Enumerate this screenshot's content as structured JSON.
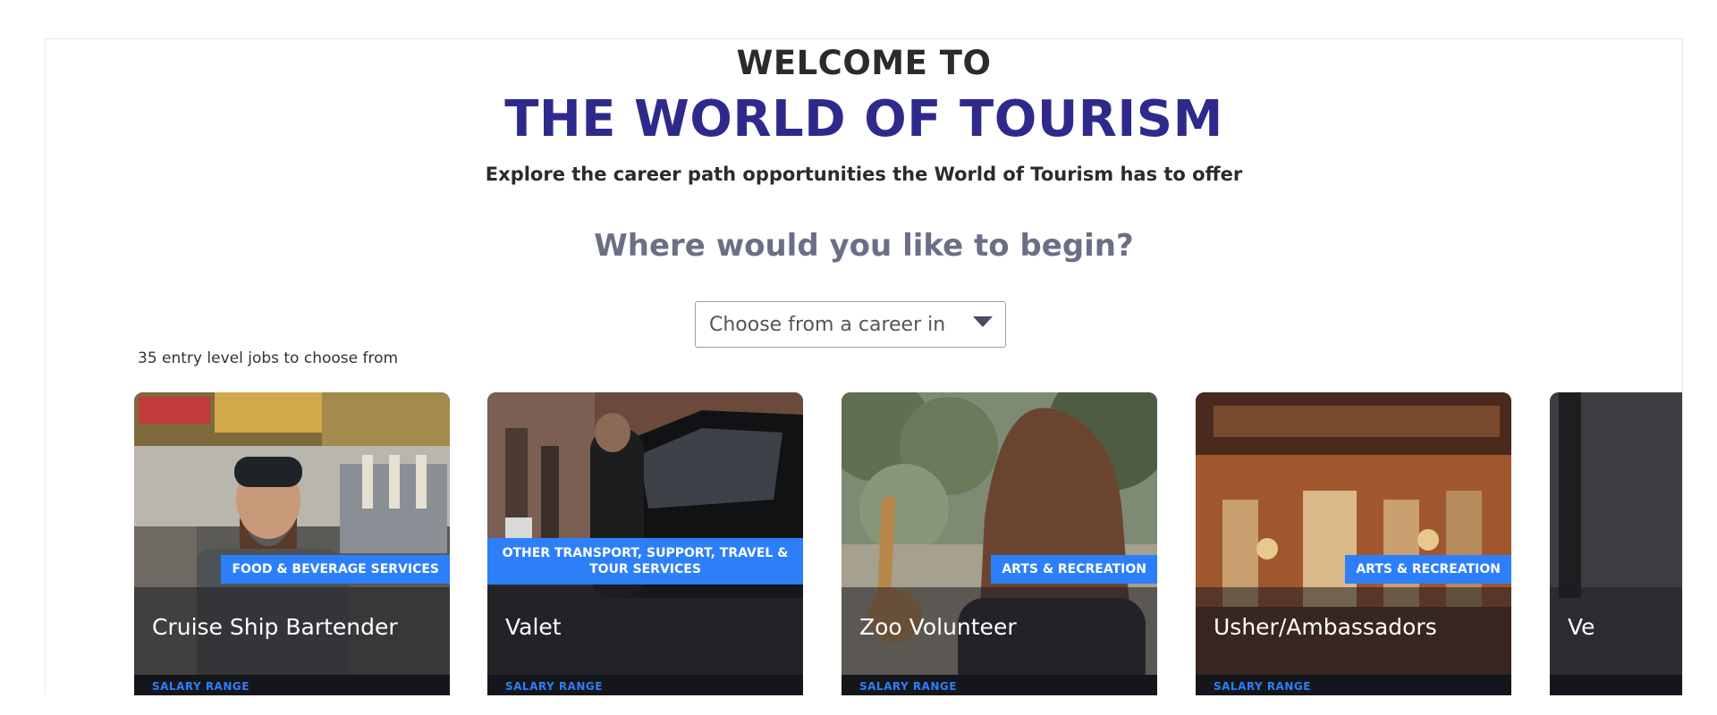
{
  "hero": {
    "welcome": "WELCOME TO",
    "title": "THE WORLD OF TOURISM",
    "subtitle": "Explore the career path opportunities the World of Tourism has to offer",
    "question": "Where would you like to begin?"
  },
  "career_select": {
    "selected": "Choose from a career in",
    "icon": "caret-down-icon"
  },
  "jobs_count_text": "35 entry level jobs to choose from",
  "cards": [
    {
      "name": "Cruise Ship Bartender",
      "category": "FOOD & BEVERAGE SERVICES",
      "salary_label": "SALARY RANGE"
    },
    {
      "name": "Valet",
      "category": "OTHER TRANSPORT, SUPPORT, TRAVEL & TOUR SERVICES",
      "salary_label": "SALARY RANGE"
    },
    {
      "name": "Zoo Volunteer",
      "category": "ARTS & RECREATION",
      "salary_label": "SALARY RANGE"
    },
    {
      "name": "Usher/Ambassadors",
      "category": "ARTS & RECREATION",
      "salary_label": "SALARY RANGE"
    },
    {
      "name": "Ve"
    }
  ],
  "colors": {
    "title": "#2e2a8c",
    "question": "#6b6f86",
    "badge": "#2d7ff9",
    "card_footer": "#14161b"
  }
}
